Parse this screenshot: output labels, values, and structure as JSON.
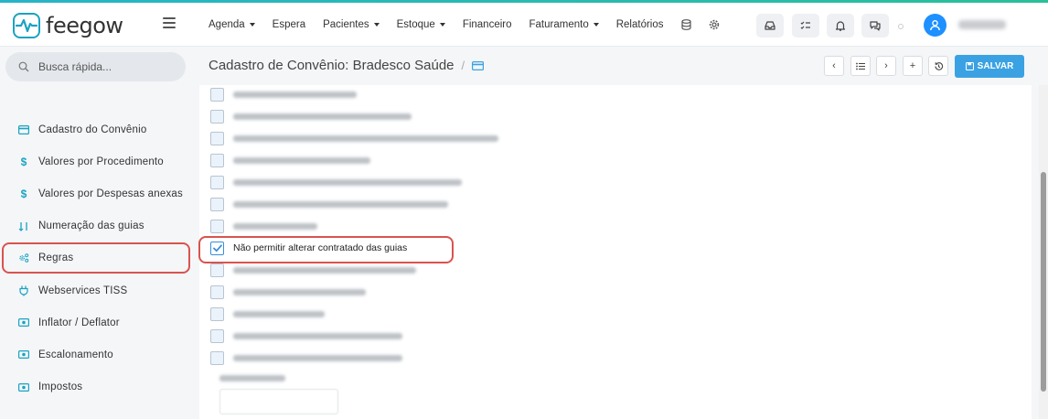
{
  "app": {
    "logo_text": "feegow",
    "brand_color": "#1aa3c2",
    "accent_color": "#3aa2e3",
    "highlight_color": "#d9534f"
  },
  "nav": {
    "items": [
      {
        "label": "Agenda",
        "has_caret": true
      },
      {
        "label": "Espera",
        "has_caret": false
      },
      {
        "label": "Pacientes",
        "has_caret": true
      },
      {
        "label": "Estoque",
        "has_caret": true
      },
      {
        "label": "Financeiro",
        "has_caret": false
      },
      {
        "label": "Faturamento",
        "has_caret": true
      },
      {
        "label": "Relatórios",
        "has_caret": false
      }
    ]
  },
  "search": {
    "placeholder": "Busca rápida..."
  },
  "sidebar": {
    "items": [
      {
        "label": "Cadastro do Convênio",
        "icon": "card-icon"
      },
      {
        "label": "Valores por Procedimento",
        "icon": "dollar-icon"
      },
      {
        "label": "Valores por Despesas anexas",
        "icon": "dollar-icon"
      },
      {
        "label": "Numeração das guias",
        "icon": "sort-numeric-icon"
      },
      {
        "label": "Regras",
        "icon": "gears-icon"
      },
      {
        "label": "Webservices TISS",
        "icon": "plug-icon"
      },
      {
        "label": "Inflator / Deflator",
        "icon": "money-icon"
      },
      {
        "label": "Escalonamento",
        "icon": "money-icon"
      },
      {
        "label": "Impostos",
        "icon": "money-icon"
      }
    ],
    "active_index": 4
  },
  "page": {
    "title": "Cadastro de Convênio: Bradesco Saúde",
    "save_label": "SALVAR"
  },
  "rules": {
    "checked_rule_label": "Não permitir alterar contratado das guias"
  }
}
